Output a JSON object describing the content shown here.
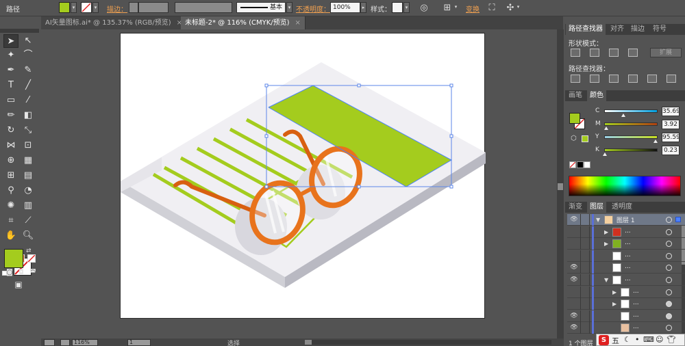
{
  "control_bar": {
    "object_type": "路径",
    "stroke_label": "描边：",
    "brush_label": "基本",
    "opacity_label": "不透明度：",
    "opacity_value": "100%",
    "style_label": "样式：",
    "transform_label": "变换",
    "fill_color": "#a4cc1e"
  },
  "document_tabs": [
    {
      "label": "AI矢量图标.ai* @ 135.37% (RGB/预览)",
      "active": false
    },
    {
      "label": "未标题-2* @ 116% (CMYK/预览)",
      "active": true
    }
  ],
  "tab_close_glyph": "×",
  "status_bar": {
    "zoom": "116%",
    "page": "1",
    "tool": "选择"
  },
  "pathfinder_panel": {
    "tabs": [
      "路径查找器",
      "对齐",
      "描边",
      "符号"
    ],
    "shape_modes_label": "形状模式：",
    "expand_label": "扩展",
    "pathfinders_label": "路径查找器："
  },
  "color_panel": {
    "tabs": [
      "画笔",
      "颜色"
    ],
    "channels": [
      {
        "name": "C",
        "value": "35.69",
        "fraction": 0.36,
        "gradient": "linear-gradient(to right,#ffffff,#00a0e0)"
      },
      {
        "name": "M",
        "value": "3.92",
        "fraction": 0.04,
        "gradient": "linear-gradient(to right,#a4cc1e,#b04010)"
      },
      {
        "name": "Y",
        "value": "95.59",
        "fraction": 0.96,
        "gradient": "linear-gradient(to right,#9ad0e8,#c8e020)"
      },
      {
        "name": "K",
        "value": "0.23",
        "fraction": 0.01,
        "gradient": "linear-gradient(to right,#a4cc1e,#101010)"
      }
    ],
    "fill_color": "#a4cc1e"
  },
  "layers_panel": {
    "tabs": [
      "渐变",
      "图层",
      "透明度"
    ],
    "rows": [
      {
        "name": "图层 1",
        "indent": 0,
        "expanded": true,
        "selected": true,
        "visible": true,
        "target_filled": false,
        "show_sel": true
      },
      {
        "name": "...",
        "indent": 1,
        "expanded": false,
        "selected": false,
        "visible": false,
        "target_filled": false,
        "show_sel": false
      },
      {
        "name": "...",
        "indent": 1,
        "expanded": false,
        "selected": false,
        "visible": false,
        "target_filled": false,
        "show_sel": false
      },
      {
        "name": "...",
        "indent": 1,
        "expanded": null,
        "selected": false,
        "visible": false,
        "target_filled": false,
        "show_sel": false
      },
      {
        "name": "...",
        "indent": 1,
        "expanded": null,
        "selected": false,
        "visible": true,
        "target_filled": false,
        "show_sel": false
      },
      {
        "name": "...",
        "indent": 1,
        "expanded": true,
        "selected": false,
        "visible": true,
        "target_filled": false,
        "show_sel": false
      },
      {
        "name": "...",
        "indent": 2,
        "expanded": false,
        "selected": false,
        "visible": false,
        "target_filled": false,
        "show_sel": false
      },
      {
        "name": "...",
        "indent": 2,
        "expanded": false,
        "selected": false,
        "visible": false,
        "target_filled": true,
        "show_sel": false
      },
      {
        "name": "...",
        "indent": 2,
        "expanded": null,
        "selected": false,
        "visible": true,
        "target_filled": true,
        "show_sel": false
      },
      {
        "name": "...",
        "indent": 2,
        "expanded": null,
        "selected": false,
        "visible": true,
        "target_filled": false,
        "show_sel": false
      }
    ],
    "footer": "1 个图层"
  },
  "taskbar": {
    "ime_label": "S",
    "ime_mode": "五"
  },
  "icons": {
    "eye": "👁",
    "expand_open": "▼",
    "expand_closed": "▶",
    "dropdown": "▾"
  },
  "colors": {
    "accent_green": "#a4cc1e",
    "glasses_orange": "#e8731c",
    "selection_blue": "#4a80ff"
  }
}
